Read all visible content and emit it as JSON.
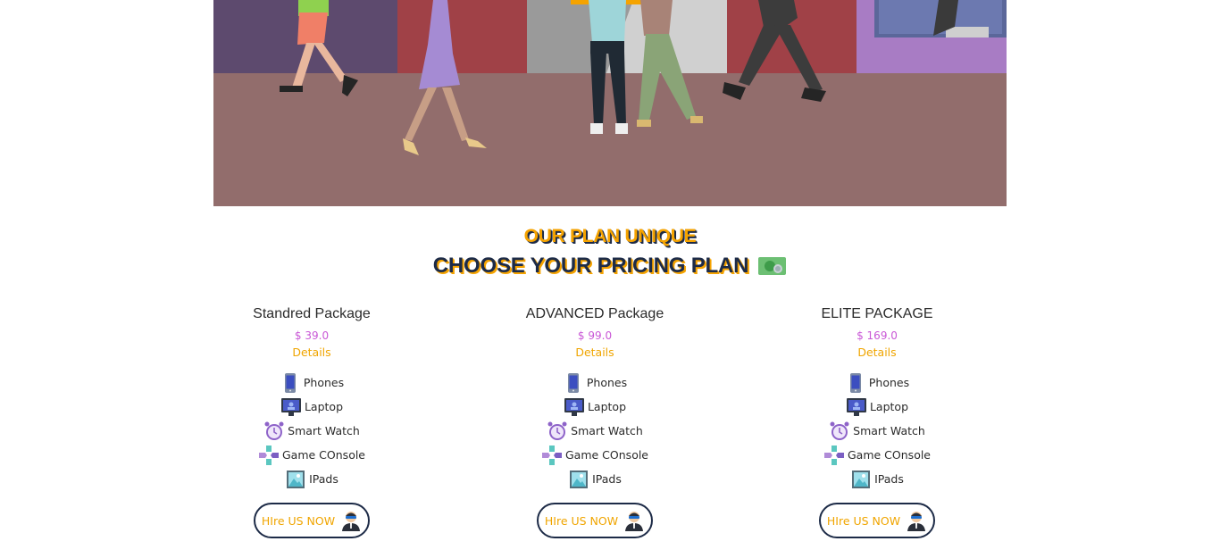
{
  "section": {
    "sub_title": "OUR PLAN UNIQUE",
    "main_title": "CHOOSE YOUR PRICING PLAN"
  },
  "colors": {
    "accent_orange": "#f5a300",
    "navy": "#1d2b47",
    "price_purple": "#c957d6"
  },
  "icons": {
    "title": "money-icon",
    "features": [
      "phone-icon",
      "laptop-icon",
      "alarm-clock-icon",
      "game-controller-icon",
      "picture-icon"
    ],
    "button": "agent-icon"
  },
  "plans": [
    {
      "name": "Standred Package",
      "price": "$ 39.0",
      "details": "Details",
      "features": [
        "Phones",
        "Laptop",
        "Smart Watch",
        "Game COnsole",
        "IPads"
      ],
      "button_label": "HIre US NOW"
    },
    {
      "name": "ADVANCED Package",
      "price": "$ 99.0",
      "details": "Details",
      "features": [
        "Phones",
        "Laptop",
        "Smart Watch",
        "Game COnsole",
        "IPads"
      ],
      "button_label": "HIre US NOW"
    },
    {
      "name": "ELITE PACKAGE",
      "price": "$ 169.0",
      "details": "Details",
      "features": [
        "Phones",
        "Laptop",
        "Smart Watch",
        "Game COnsole",
        "IPads"
      ],
      "button_label": "HIre US NOW"
    }
  ]
}
